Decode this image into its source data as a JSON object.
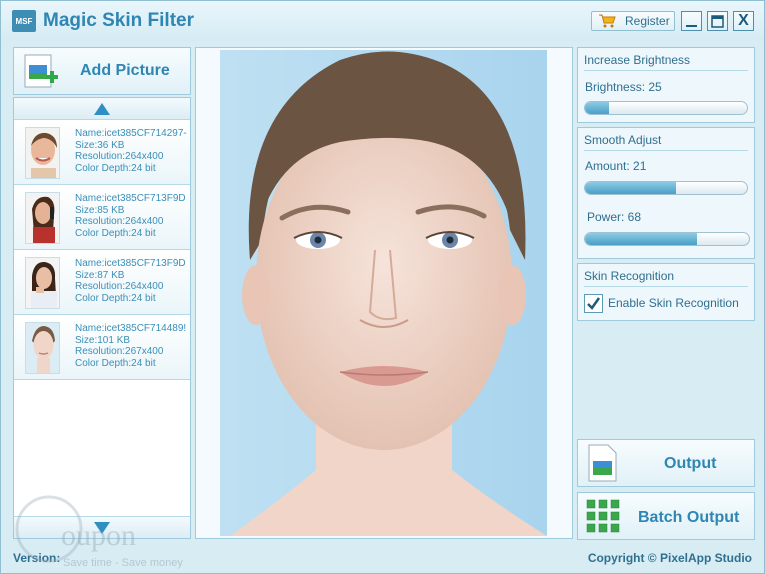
{
  "app": {
    "logo_text": "MSF",
    "title": "Magic Skin Filter"
  },
  "titlebar": {
    "register_label": "Register",
    "minimize_label": "_",
    "maximize_label": "□",
    "close_label": "X"
  },
  "left": {
    "add_picture_label": "Add Picture",
    "items": [
      {
        "name": "Name:icet385CF714297-",
        "size": "Size:36 KB",
        "resolution": "Resolution:264x400",
        "depth": "Color Depth:24 bit"
      },
      {
        "name": "Name:icet385CF713F9D",
        "size": "Size:85 KB",
        "resolution": "Resolution:264x400",
        "depth": "Color Depth:24 bit"
      },
      {
        "name": "Name:icet385CF713F9D",
        "size": "Size:87 KB",
        "resolution": "Resolution:264x400",
        "depth": "Color Depth:24 bit"
      },
      {
        "name": "Name:icet385CF714489!",
        "size": "Size:101 KB",
        "resolution": "Resolution:267x400",
        "depth": "Color Depth:24 bit"
      }
    ]
  },
  "right": {
    "brightness": {
      "title": "Increase Brightness",
      "label": "Brightness: 25",
      "level": 0.15
    },
    "smooth": {
      "title": "Smooth Adjust",
      "amount_label": "Amount: 21",
      "amount_level": 0.56,
      "power_label": "Power: 68",
      "power_level": 0.68
    },
    "skin": {
      "title": "Skin Recognition",
      "checkbox_label": "Enable Skin Recognition",
      "checked": true
    },
    "output_label": "Output",
    "batch_output_label": "Batch Output"
  },
  "status": {
    "version_label": "Version:",
    "copyright": "Copyright © PixelApp Studio"
  },
  "watermark": {
    "brand": "oupon",
    "tagline": "Save time - Save money"
  },
  "colors": {
    "accent": "#2f86b3",
    "panel_border": "#9fcade",
    "background": "#d8ecf3",
    "slider_fill": "#4a9fc6"
  }
}
